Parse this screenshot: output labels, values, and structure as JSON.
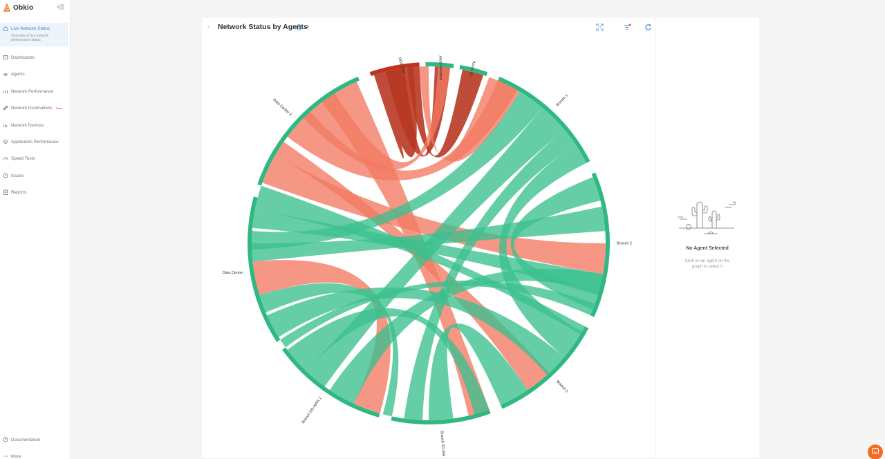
{
  "app": {
    "brand": "Obkio"
  },
  "sidebar": {
    "active_sub": "Overview of live network performance status",
    "items": [
      {
        "label": "Live Network Status",
        "icon": "home-icon",
        "top": 0
      },
      {
        "label": "Dashboards",
        "icon": "dashboard-icon"
      },
      {
        "label": "Agents",
        "icon": "agents-icon"
      },
      {
        "label": "Network Performance",
        "icon": "bar-chart-icon"
      },
      {
        "label": "Network Destinations",
        "icon": "link-icon",
        "badge": "New"
      },
      {
        "label": "Network Devices",
        "icon": "devices-icon"
      },
      {
        "label": "Application Performance",
        "icon": "layers-icon"
      },
      {
        "label": "Speed Tests",
        "icon": "gauge-icon"
      },
      {
        "label": "Issues",
        "icon": "clock-icon"
      },
      {
        "label": "Reports",
        "icon": "report-icon"
      }
    ],
    "footer": [
      {
        "label": "Documentation",
        "icon": "help-circle-icon"
      },
      {
        "label": "More",
        "icon": "more-icon"
      }
    ]
  },
  "header": {
    "title": "Network Status by Agents"
  },
  "chord": {
    "colors": {
      "ok": "#3bc08e",
      "warn": "#f27a62",
      "bad": "#b73824",
      "ring_ok": "#2fb882",
      "ring_warn": "#f27a62",
      "ring_bad": "#c0321f"
    },
    "labels": {
      "rdc_test": "RDC Test",
      "aws_montreal": "AWS-Montreal",
      "azure_qc": "Azure-QC",
      "branch1": "Branch 1",
      "branch2": "Branch 2",
      "branch3": "Branch 3",
      "branch_sdwan": "Branch SD-WAN",
      "branch_sdwan1": "Branch SD-WAN 1",
      "data_center": "Data Center",
      "data_center2": "Data Center 2"
    }
  },
  "details": {
    "empty_title": "No Agent Selected",
    "empty_desc": "Click on an agent on the graph to select it"
  }
}
